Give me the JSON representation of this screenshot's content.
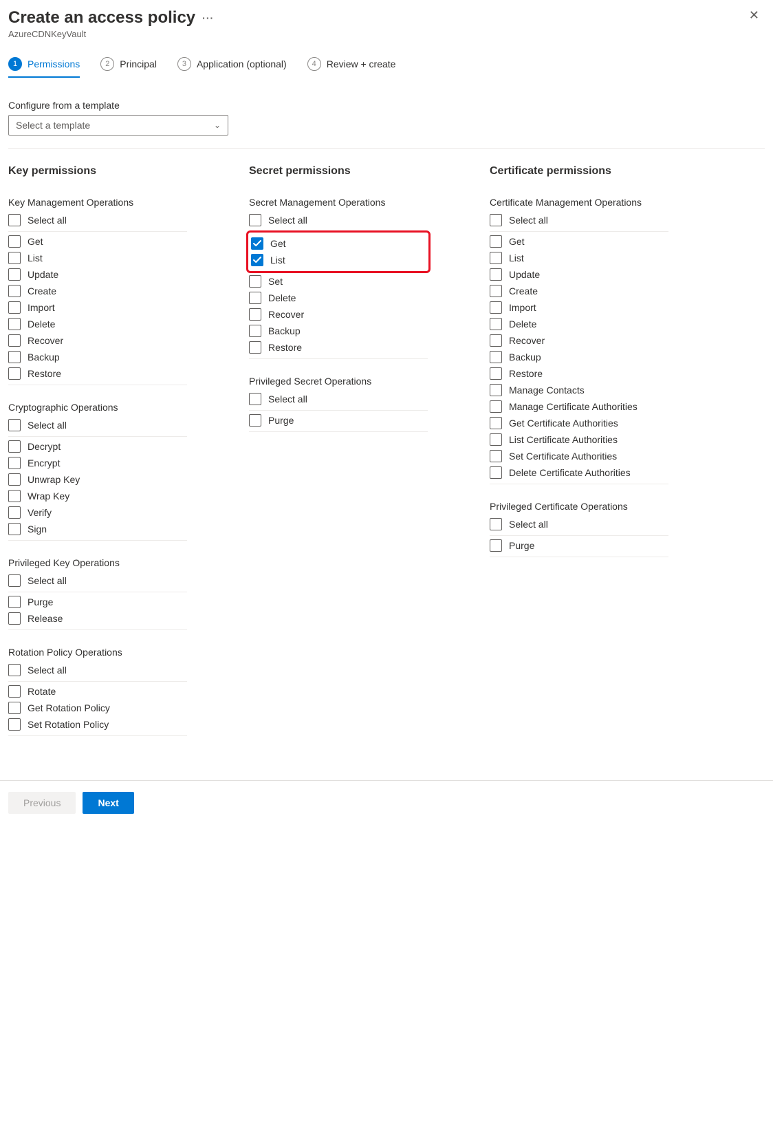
{
  "header": {
    "title": "Create an access policy",
    "subtitle": "AzureCDNKeyVault"
  },
  "tabs": [
    {
      "num": "1",
      "label": "Permissions",
      "active": true
    },
    {
      "num": "2",
      "label": "Principal",
      "active": false
    },
    {
      "num": "3",
      "label": "Application (optional)",
      "active": false
    },
    {
      "num": "4",
      "label": "Review + create",
      "active": false
    }
  ],
  "template": {
    "label": "Configure from a template",
    "placeholder": "Select a template"
  },
  "columns": [
    {
      "title": "Key permissions",
      "groups": [
        {
          "label": "Key Management Operations",
          "select_all": "Select all",
          "items": [
            {
              "label": "Get",
              "checked": false
            },
            {
              "label": "List",
              "checked": false
            },
            {
              "label": "Update",
              "checked": false
            },
            {
              "label": "Create",
              "checked": false
            },
            {
              "label": "Import",
              "checked": false
            },
            {
              "label": "Delete",
              "checked": false
            },
            {
              "label": "Recover",
              "checked": false
            },
            {
              "label": "Backup",
              "checked": false
            },
            {
              "label": "Restore",
              "checked": false
            }
          ]
        },
        {
          "label": "Cryptographic Operations",
          "select_all": "Select all",
          "items": [
            {
              "label": "Decrypt",
              "checked": false
            },
            {
              "label": "Encrypt",
              "checked": false
            },
            {
              "label": "Unwrap Key",
              "checked": false
            },
            {
              "label": "Wrap Key",
              "checked": false
            },
            {
              "label": "Verify",
              "checked": false
            },
            {
              "label": "Sign",
              "checked": false
            }
          ]
        },
        {
          "label": "Privileged Key Operations",
          "select_all": "Select all",
          "items": [
            {
              "label": "Purge",
              "checked": false
            },
            {
              "label": "Release",
              "checked": false
            }
          ]
        },
        {
          "label": "Rotation Policy Operations",
          "select_all": "Select all",
          "items": [
            {
              "label": "Rotate",
              "checked": false
            },
            {
              "label": "Get Rotation Policy",
              "checked": false
            },
            {
              "label": "Set Rotation Policy",
              "checked": false
            }
          ]
        }
      ]
    },
    {
      "title": "Secret permissions",
      "groups": [
        {
          "label": "Secret Management Operations",
          "select_all": "Select all",
          "highlight_first_n": 2,
          "items": [
            {
              "label": "Get",
              "checked": true
            },
            {
              "label": "List",
              "checked": true
            },
            {
              "label": "Set",
              "checked": false
            },
            {
              "label": "Delete",
              "checked": false
            },
            {
              "label": "Recover",
              "checked": false
            },
            {
              "label": "Backup",
              "checked": false
            },
            {
              "label": "Restore",
              "checked": false
            }
          ]
        },
        {
          "label": "Privileged Secret Operations",
          "select_all": "Select all",
          "items": [
            {
              "label": "Purge",
              "checked": false
            }
          ]
        }
      ]
    },
    {
      "title": "Certificate permissions",
      "groups": [
        {
          "label": "Certificate Management Operations",
          "select_all": "Select all",
          "items": [
            {
              "label": "Get",
              "checked": false
            },
            {
              "label": "List",
              "checked": false
            },
            {
              "label": "Update",
              "checked": false
            },
            {
              "label": "Create",
              "checked": false
            },
            {
              "label": "Import",
              "checked": false
            },
            {
              "label": "Delete",
              "checked": false
            },
            {
              "label": "Recover",
              "checked": false
            },
            {
              "label": "Backup",
              "checked": false
            },
            {
              "label": "Restore",
              "checked": false
            },
            {
              "label": "Manage Contacts",
              "checked": false
            },
            {
              "label": "Manage Certificate Authorities",
              "checked": false
            },
            {
              "label": "Get Certificate Authorities",
              "checked": false
            },
            {
              "label": "List Certificate Authorities",
              "checked": false
            },
            {
              "label": "Set Certificate Authorities",
              "checked": false
            },
            {
              "label": "Delete Certificate Authorities",
              "checked": false
            }
          ]
        },
        {
          "label": "Privileged Certificate Operations",
          "select_all": "Select all",
          "items": [
            {
              "label": "Purge",
              "checked": false
            }
          ]
        }
      ]
    }
  ],
  "footer": {
    "previous": "Previous",
    "next": "Next"
  }
}
